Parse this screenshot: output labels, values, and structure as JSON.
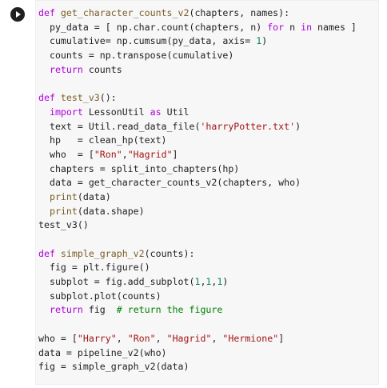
{
  "cell": {
    "run_icon": "play-icon",
    "lines": [
      [
        [
          "kw",
          "def "
        ],
        [
          "fn",
          "get_character_counts_v2"
        ],
        [
          "op",
          "(chapters, names):"
        ]
      ],
      [
        [
          "op",
          "  py_data = [ np.char.count(chapters, n) "
        ],
        [
          "kw",
          "for"
        ],
        [
          "op",
          " n "
        ],
        [
          "kw",
          "in"
        ],
        [
          "op",
          " names ]"
        ]
      ],
      [
        [
          "op",
          "  cumulative= np.cumsum(py_data, axis= "
        ],
        [
          "num",
          "1"
        ],
        [
          "op",
          ")"
        ]
      ],
      [
        [
          "op",
          "  counts = np.transpose(cumulative)"
        ]
      ],
      [
        [
          "op",
          "  "
        ],
        [
          "kw",
          "return"
        ],
        [
          "op",
          " counts"
        ]
      ],
      [
        [
          "op",
          ""
        ]
      ],
      [
        [
          "kw",
          "def "
        ],
        [
          "fn",
          "test_v3"
        ],
        [
          "op",
          "():"
        ]
      ],
      [
        [
          "op",
          "  "
        ],
        [
          "kw",
          "import"
        ],
        [
          "op",
          " LessonUtil "
        ],
        [
          "kw",
          "as"
        ],
        [
          "op",
          " Util"
        ]
      ],
      [
        [
          "op",
          "  text = Util.read_data_file("
        ],
        [
          "str",
          "'harryPotter.txt'"
        ],
        [
          "op",
          ")"
        ]
      ],
      [
        [
          "op",
          "  hp   = clean_hp(text)"
        ]
      ],
      [
        [
          "op",
          "  who  = ["
        ],
        [
          "str",
          "\"Ron\""
        ],
        [
          "op",
          ","
        ],
        [
          "str",
          "\"Hagrid\""
        ],
        [
          "op",
          "]"
        ]
      ],
      [
        [
          "op",
          "  chapters = split_into_chapters(hp)"
        ]
      ],
      [
        [
          "op",
          "  data = get_character_counts_v2(chapters, who)"
        ]
      ],
      [
        [
          "op",
          "  "
        ],
        [
          "fn",
          "print"
        ],
        [
          "op",
          "(data)"
        ]
      ],
      [
        [
          "op",
          "  "
        ],
        [
          "fn",
          "print"
        ],
        [
          "op",
          "(data.shape)"
        ]
      ],
      [
        [
          "op",
          "test_v3()"
        ]
      ],
      [
        [
          "op",
          ""
        ]
      ],
      [
        [
          "kw",
          "def "
        ],
        [
          "fn",
          "simple_graph_v2"
        ],
        [
          "op",
          "(counts):"
        ]
      ],
      [
        [
          "op",
          "  fig = plt.figure()"
        ]
      ],
      [
        [
          "op",
          "  subplot = fig.add_subplot("
        ],
        [
          "num",
          "1"
        ],
        [
          "op",
          ","
        ],
        [
          "num",
          "1"
        ],
        [
          "op",
          ","
        ],
        [
          "num",
          "1"
        ],
        [
          "op",
          ")"
        ]
      ],
      [
        [
          "op",
          "  subplot.plot(counts)"
        ]
      ],
      [
        [
          "op",
          "  "
        ],
        [
          "kw",
          "return"
        ],
        [
          "op",
          " fig  "
        ],
        [
          "cm",
          "# return the figure"
        ]
      ],
      [
        [
          "op",
          ""
        ]
      ],
      [
        [
          "op",
          "who = ["
        ],
        [
          "str",
          "\"Harry\""
        ],
        [
          "op",
          ", "
        ],
        [
          "str",
          "\"Ron\""
        ],
        [
          "op",
          ", "
        ],
        [
          "str",
          "\"Hagrid\""
        ],
        [
          "op",
          ", "
        ],
        [
          "str",
          "\"Hermione\""
        ],
        [
          "op",
          "]"
        ]
      ],
      [
        [
          "op",
          "data = pipeline_v2(who)"
        ]
      ],
      [
        [
          "op",
          "fig = simple_graph_v2(data)"
        ]
      ]
    ]
  }
}
